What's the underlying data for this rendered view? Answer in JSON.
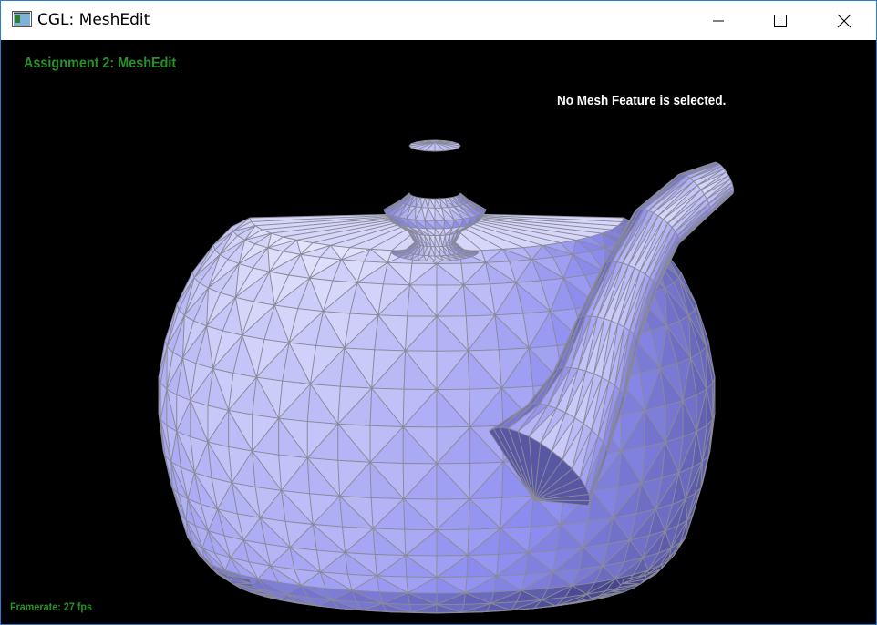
{
  "window": {
    "title": "CGL: MeshEdit",
    "controls": {
      "minimize": "minimize",
      "maximize": "maximize",
      "close": "close"
    }
  },
  "icons": {
    "app": "app-window-icon",
    "minimize": "minimize-icon",
    "maximize": "maximize-icon",
    "close": "close-icon"
  },
  "viewport": {
    "background": "#000000",
    "assignment_title": "Assignment 2: MeshEdit",
    "selection_status": "No Mesh Feature is selected.",
    "framerate": "Framerate: 27 fps"
  },
  "mesh": {
    "name": "teapot",
    "base_color": "#b8b8f4",
    "edge_color": "#8a8a9a"
  },
  "colors": {
    "hud_green": "#2a8f2a",
    "hud_white": "#ffffff"
  }
}
